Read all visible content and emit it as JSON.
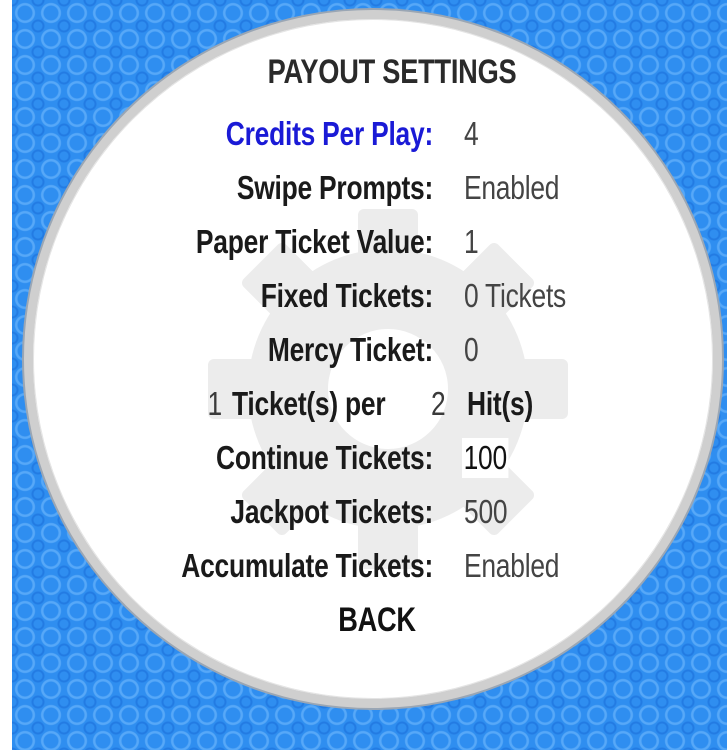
{
  "title": "PAYOUT SETTINGS",
  "settings": [
    {
      "label": "Credits Per Play:",
      "value": "4"
    },
    {
      "label": "Swipe Prompts:",
      "value": "Enabled"
    },
    {
      "label": "Paper Ticket Value:",
      "value": "1"
    },
    {
      "label": "Fixed Tickets:",
      "value": "0 Tickets"
    },
    {
      "label": "Mercy Ticket:",
      "value": "0"
    },
    {
      "label": "Continue Tickets:",
      "value": "100"
    },
    {
      "label": "Jackpot Tickets:",
      "value": "500"
    },
    {
      "label": "Accumulate Tickets:",
      "value": "Enabled"
    }
  ],
  "ratio": {
    "tickets_count": "1",
    "tickets_label": "Ticket(s) per",
    "hits_count": "2",
    "hits_label": "Hit(s)"
  },
  "back_label": "BACK",
  "colors": {
    "background": "#2f8ef0",
    "selected_label": "#1a1ad6",
    "dial": "#ffffff",
    "dial_rim": "#cfcfcf"
  },
  "icons": {
    "background_pattern": "bubble-pattern-icon",
    "watermark": "gear-icon"
  }
}
